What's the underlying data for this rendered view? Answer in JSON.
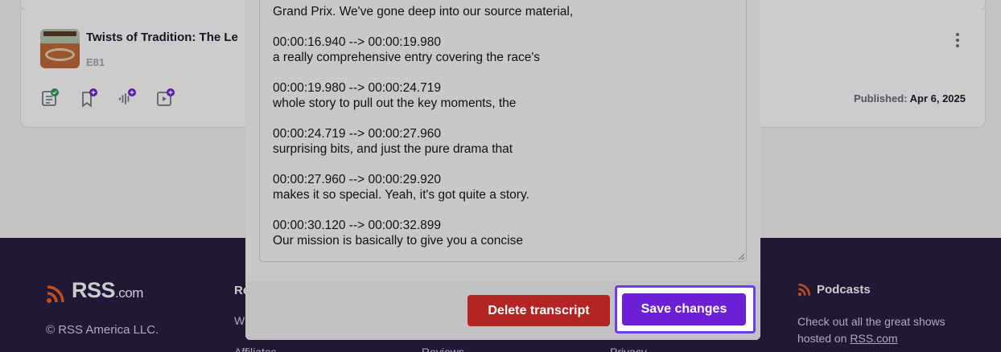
{
  "episode": {
    "title": "Twists of Tradition: The Le",
    "number": "E81",
    "published_label": "Published:",
    "published_date": "Apr 6, 2025",
    "actions": [
      "transcript-icon",
      "bookmark-add-icon",
      "audio-add-icon",
      "video-add-icon"
    ]
  },
  "footer": {
    "brand_main": "RSS",
    "brand_suffix": ".com",
    "copyright": "© RSS America LLC.",
    "col1_head": "Re",
    "col1_link1": "W",
    "col1_link2": "Affiliates",
    "col2_link": "Reviews",
    "col3_link": "Privacy ...",
    "podcasts_head": "Podcasts",
    "podcasts_text": "Check out all the great shows hosted on ",
    "podcasts_link": "RSS.com"
  },
  "transcript": {
    "top_line": "Grand Prix. We've gone deep into our source material,",
    "cues": [
      {
        "time": "00:00:16.940 --> 00:00:19.980",
        "text": "a really comprehensive entry covering the race's"
      },
      {
        "time": "00:00:19.980 --> 00:00:24.719",
        "text": "whole story to pull out the key moments, the"
      },
      {
        "time": "00:00:24.719 --> 00:00:27.960",
        "text": "surprising bits, and just the pure drama that"
      },
      {
        "time": "00:00:27.960 --> 00:00:29.920",
        "text": "makes it so special. Yeah, it's got quite a story."
      },
      {
        "time": "00:00:30.120 --> 00:00:32.899",
        "text": "Our mission is basically to give you a concise"
      }
    ]
  },
  "modal": {
    "delete_label": "Delete transcript",
    "save_label": "Save changes"
  },
  "colors": {
    "accent": "#6d1fd6",
    "danger": "#b32424",
    "footer_bg": "#2a1f44",
    "rss_orange": "#f26522"
  }
}
